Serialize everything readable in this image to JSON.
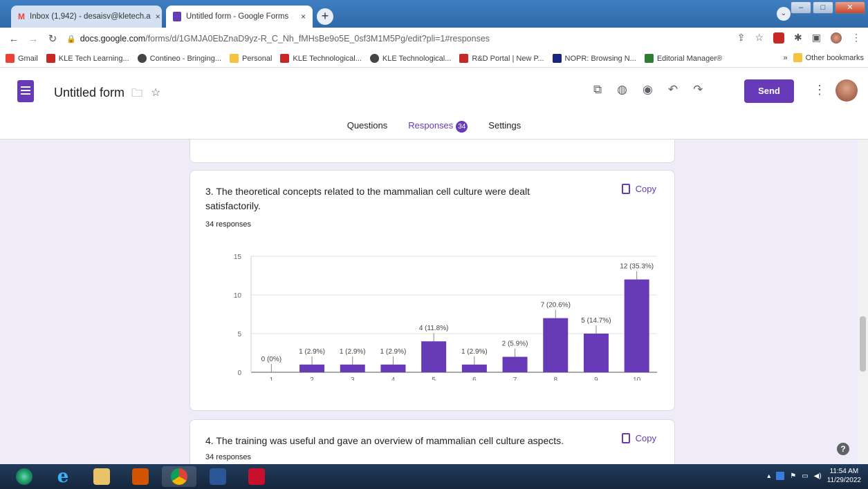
{
  "browser": {
    "tabs": [
      {
        "label": "Inbox (1,942) - desaisv@kletech.a",
        "close": "×"
      },
      {
        "label": "Untitled form - Google Forms",
        "close": "×"
      }
    ],
    "new_tab": "+",
    "url_host": "docs.google.com",
    "url_path": "/forms/d/1GMJA0EbZnaD9yz-R_C_Nh_fMHsBe9o5E_0sf3M1M5Pg/edit?pli=1#responses",
    "bookmarks": [
      {
        "label": "Gmail",
        "color": "#ea4335"
      },
      {
        "label": "KLE Tech Learning...",
        "color": "#c62828"
      },
      {
        "label": "Contineo - Bringing...",
        "color": "#444444"
      },
      {
        "label": "Personal",
        "color": "#f5c242"
      },
      {
        "label": "KLE Technological...",
        "color": "#c62828"
      },
      {
        "label": "KLE Technological...",
        "color": "#444444"
      },
      {
        "label": "R&D Portal | New P...",
        "color": "#c62828"
      },
      {
        "label": "NOPR: Browsing N...",
        "color": "#1a237e"
      },
      {
        "label": "Editorial Manager®",
        "color": "#2e7d32"
      }
    ],
    "bookmarks_more": "»",
    "other_bookmarks": "Other bookmarks"
  },
  "form": {
    "title": "Untitled form",
    "send_label": "Send",
    "tabs": {
      "questions": "Questions",
      "responses": "Responses",
      "responses_count": "34",
      "settings": "Settings"
    }
  },
  "questions": [
    {
      "text": "3. The theoretical concepts related to the mammalian cell culture were dealt satisfactorily.",
      "count": "34 responses",
      "copy_label": "Copy"
    },
    {
      "text": "4. The training was useful and gave an overview of mammalian cell culture aspects.",
      "count": "34 responses",
      "copy_label": "Copy"
    }
  ],
  "chart_data": {
    "type": "bar",
    "categories": [
      "1",
      "2",
      "3",
      "4",
      "5",
      "6",
      "7",
      "8",
      "9",
      "10"
    ],
    "values": [
      0,
      1,
      1,
      1,
      4,
      1,
      2,
      7,
      5,
      12
    ],
    "data_labels": [
      "0 (0%)",
      "1 (2.9%)",
      "1 (2.9%)",
      "1 (2.9%)",
      "4 (11.8%)",
      "1 (2.9%)",
      "2 (5.9%)",
      "7 (20.6%)",
      "5 (14.7%)",
      "12 (35.3%)"
    ],
    "yticks": [
      "0",
      "5",
      "10",
      "15"
    ],
    "ylim": [
      0,
      15
    ],
    "color": "#673ab7",
    "grid": true
  },
  "taskbar": {
    "time": "11:54 AM",
    "date": "11/29/2022"
  }
}
